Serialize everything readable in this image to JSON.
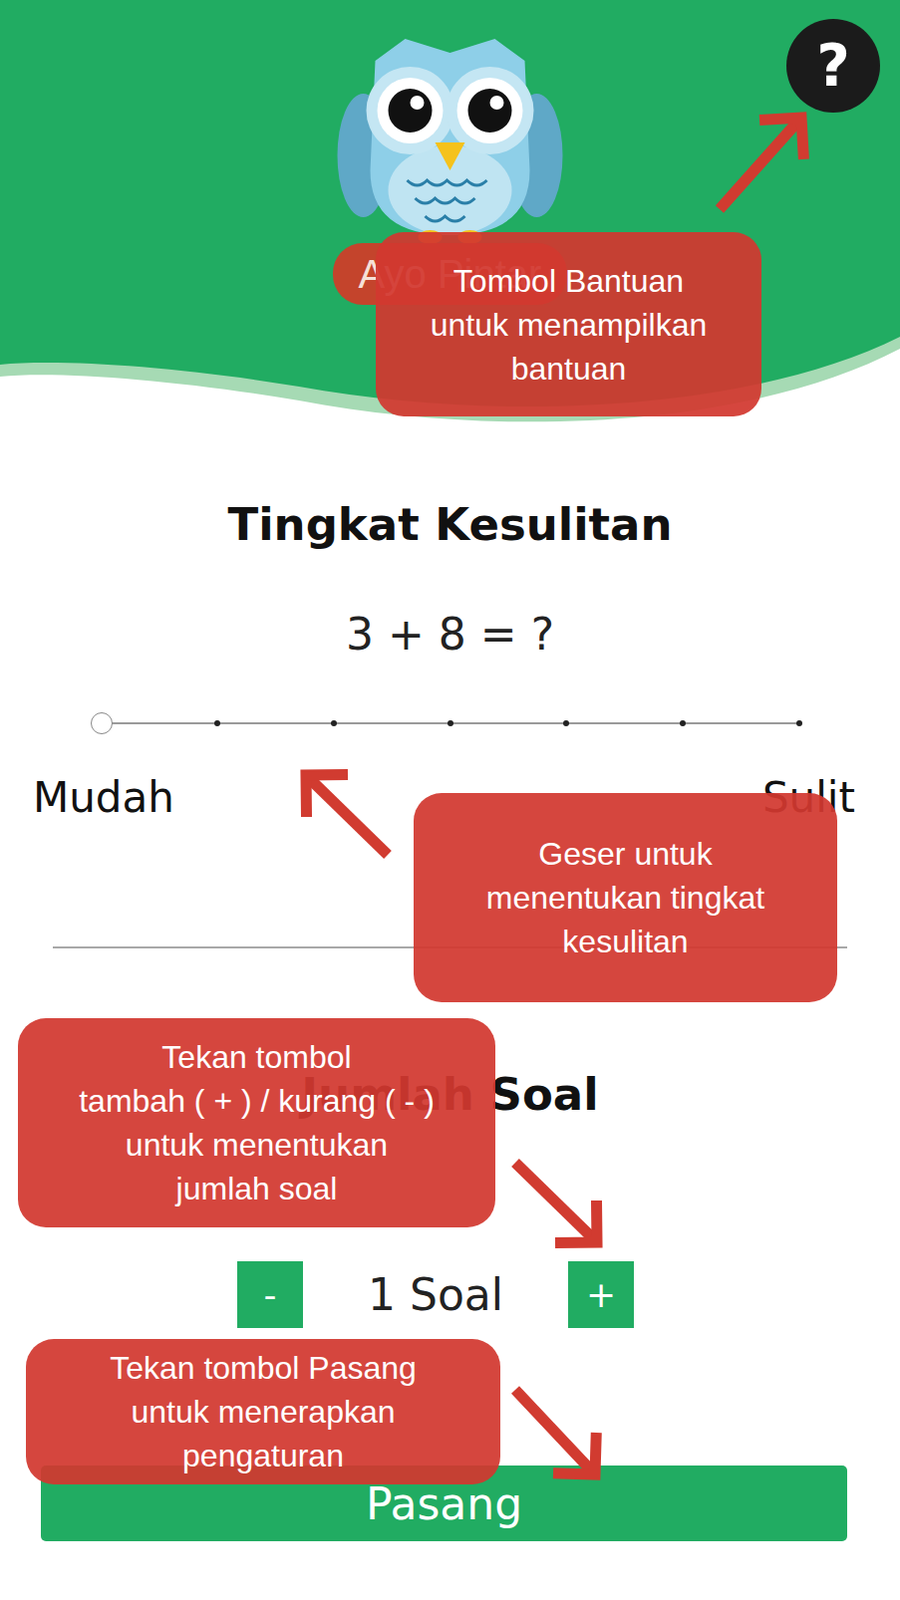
{
  "header": {
    "title": "Ayo Pintar",
    "help_button": {
      "label": "?"
    }
  },
  "difficulty": {
    "heading": "Tingkat Kesulitan",
    "example": "3 + 8 = ?",
    "level": 0,
    "ticks": 7,
    "min_label": "Mudah",
    "max_label": "Sulit"
  },
  "question_count": {
    "heading": "Jumlah Soal",
    "decrement": "-",
    "value": "1 Soal",
    "increment": "+"
  },
  "apply_button": {
    "label": "Pasang"
  },
  "tooltips": [
    {
      "kind": "help",
      "lines": [
        "Tombol Bantuan",
        "untuk menampilkan",
        "bantuan"
      ]
    },
    {
      "kind": "difficulty",
      "lines": [
        "Geser untuk",
        "menentukan tingkat",
        "kesulitan"
      ]
    },
    {
      "kind": "count",
      "lines": [
        "Tekan tombol",
        "tambah ( + ) / kurang ( - )",
        "untuk menentukan",
        "jumlah soal"
      ]
    },
    {
      "kind": "apply",
      "lines": [
        "Tekan tombol Pasang",
        "untuk menerapkan",
        "pengaturan"
      ]
    }
  ]
}
